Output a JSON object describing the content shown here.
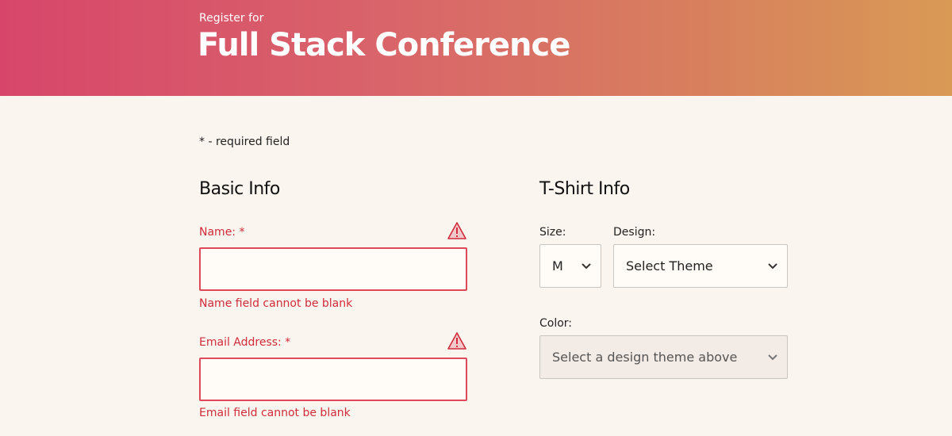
{
  "header": {
    "kicker": "Register for",
    "title": "Full Stack Conference",
    "gradient_start": "#d7466a",
    "gradient_end": "#d99a55"
  },
  "required_note": "* - required field",
  "basic_info": {
    "title": "Basic Info",
    "name": {
      "label": "Name: *",
      "value": "",
      "error": "Name field cannot be blank"
    },
    "email": {
      "label": "Email Address: *",
      "value": "",
      "error": "Email field cannot be blank"
    }
  },
  "tshirt_info": {
    "title": "T-Shirt Info",
    "size": {
      "label": "Size:",
      "value": "M"
    },
    "design": {
      "label": "Design:",
      "value": "Select Theme"
    },
    "color": {
      "label": "Color:",
      "value": "Select a design theme above"
    }
  },
  "colors": {
    "error": "#d22b3a",
    "page_bg": "#faf5ee"
  },
  "icons": {
    "warning": "warning-icon",
    "dropdown": "chevron-down-icon"
  }
}
